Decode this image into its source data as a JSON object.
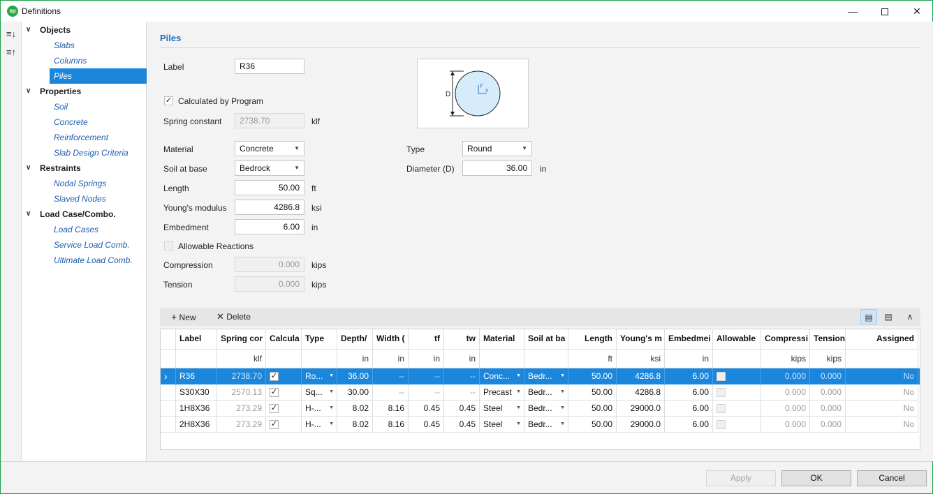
{
  "window": {
    "title": "Definitions",
    "logo_text": "sp"
  },
  "tree": {
    "groups": [
      {
        "label": "Objects",
        "items": [
          "Slabs",
          "Columns",
          "Piles"
        ]
      },
      {
        "label": "Properties",
        "items": [
          "Soil",
          "Concrete",
          "Reinforcement",
          "Slab Design Criteria"
        ]
      },
      {
        "label": "Restraints",
        "items": [
          "Nodal Springs",
          "Slaved Nodes"
        ]
      },
      {
        "label": "Load Case/Combo.",
        "items": [
          "Load Cases",
          "Service Load Comb.",
          "Ultimate Load Comb."
        ]
      }
    ],
    "selected": "Piles"
  },
  "form": {
    "section_title": "Piles",
    "label_label": "Label",
    "label_value": "R36",
    "calc_by_program": "Calculated by Program",
    "spring_constant_label": "Spring constant",
    "spring_constant_value": "2738.70",
    "spring_constant_unit": "klf",
    "material_label": "Material",
    "material_value": "Concrete",
    "soil_label": "Soil at base",
    "soil_value": "Bedrock",
    "length_label": "Length",
    "length_value": "50.00",
    "length_unit": "ft",
    "youngs_label": "Young's modulus",
    "youngs_value": "4286.8",
    "youngs_unit": "ksi",
    "embedment_label": "Embedment",
    "embedment_value": "6.00",
    "embedment_unit": "in",
    "allowable_label": "Allowable Reactions",
    "compression_label": "Compression",
    "compression_value": "0.000",
    "compression_unit": "kips",
    "tension_label": "Tension",
    "tension_value": "0.000",
    "tension_unit": "kips",
    "type_label": "Type",
    "type_value": "Round",
    "diameter_label": "Diameter (D)",
    "diameter_value": "36.00",
    "diameter_unit": "in",
    "preview": {
      "d_label": "D",
      "y_label": "y",
      "x_label": "x"
    }
  },
  "grid_toolbar": {
    "new_label": "New",
    "delete_label": "Delete"
  },
  "grid": {
    "headers": [
      "Label",
      "Spring cor",
      "Calcula",
      "Type",
      "Depth/",
      "Width (",
      "tf",
      "tw",
      "Material",
      "Soil at ba",
      "Length",
      "Young's m",
      "Embedmei",
      "Allowable",
      "Compressi",
      "Tension",
      "Assigned"
    ],
    "units": [
      "",
      "klf",
      "",
      "",
      "in",
      "in",
      "in",
      "in",
      "",
      "",
      "ft",
      "ksi",
      "in",
      "",
      "kips",
      "kips",
      ""
    ],
    "rows": [
      [
        "R36",
        "2738.70",
        "✓",
        "Ro...",
        "36.00",
        "--",
        "--",
        "--",
        "Conc...",
        "Bedr...",
        "50.00",
        "4286.8",
        "6.00",
        "",
        "0.000",
        "0.000",
        "No"
      ],
      [
        "S30X30",
        "2570.13",
        "✓",
        "Sq...",
        "30.00",
        "--",
        "--",
        "--",
        "Precast",
        "Bedr...",
        "50.00",
        "4286.8",
        "6.00",
        "",
        "0.000",
        "0.000",
        "No"
      ],
      [
        "1H8X36",
        "273.29",
        "✓",
        "H-...",
        "8.02",
        "8.16",
        "0.45",
        "0.45",
        "Steel",
        "Bedr...",
        "50.00",
        "29000.0",
        "6.00",
        "",
        "0.000",
        "0.000",
        "No"
      ],
      [
        "2H8X36",
        "273.29",
        "✓",
        "H-...",
        "8.02",
        "8.16",
        "0.45",
        "0.45",
        "Steel",
        "Bedr...",
        "50.00",
        "29000.0",
        "6.00",
        "",
        "0.000",
        "0.000",
        "No"
      ]
    ],
    "selected_row": 0
  },
  "footer": {
    "apply_label": "Apply",
    "ok_label": "OK",
    "cancel_label": "Cancel"
  },
  "colors": {
    "accent": "#1a86dc",
    "link": "#1f5fae",
    "section_title": "#1f6fbf",
    "window_border": "#1aa34a"
  }
}
